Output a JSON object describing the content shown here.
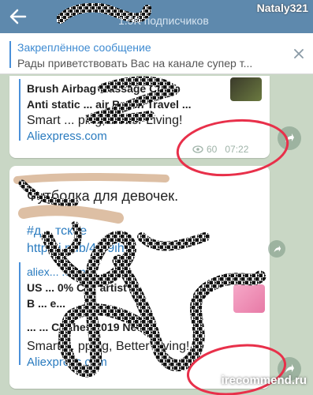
{
  "header": {
    "subscribers": "1.5K подписчиков",
    "watermark": "Nataly321"
  },
  "pinned": {
    "title": "Закреплённое сообщение",
    "text": "Рады приветствовать Вас на канале супер т..."
  },
  "message1": {
    "title_line1": "Brush Airbag Massage Comb",
    "title_line2": "Anti static ... air Brush Travel ...",
    "description": "Smart ... ping, Better Living!",
    "site": "Aliexpress.com",
    "views": "60",
    "time": "07:22"
  },
  "message2": {
    "text": "Футболка для девочек.",
    "hashtag": "#д... тское",
    "short_link": "http...i.pub/43r9ih",
    "preview_site": "aliex... .com",
    "preview_line1": "US ... 0% C ... artist",
    "preview_line2": "B ... e...",
    "preview_line3": "... ... Clothes 2019 New...",
    "description": "Smart ... pping, Better Living!",
    "site": "Aliexpress.com"
  },
  "footer": {
    "watermark": "irecommend.ru"
  },
  "colors": {
    "header": "#5e89ad",
    "chat_background": "#c9d7c5",
    "link": "#2a7bbf",
    "accent": "#4a90d9",
    "annotation": "#e8304a"
  }
}
